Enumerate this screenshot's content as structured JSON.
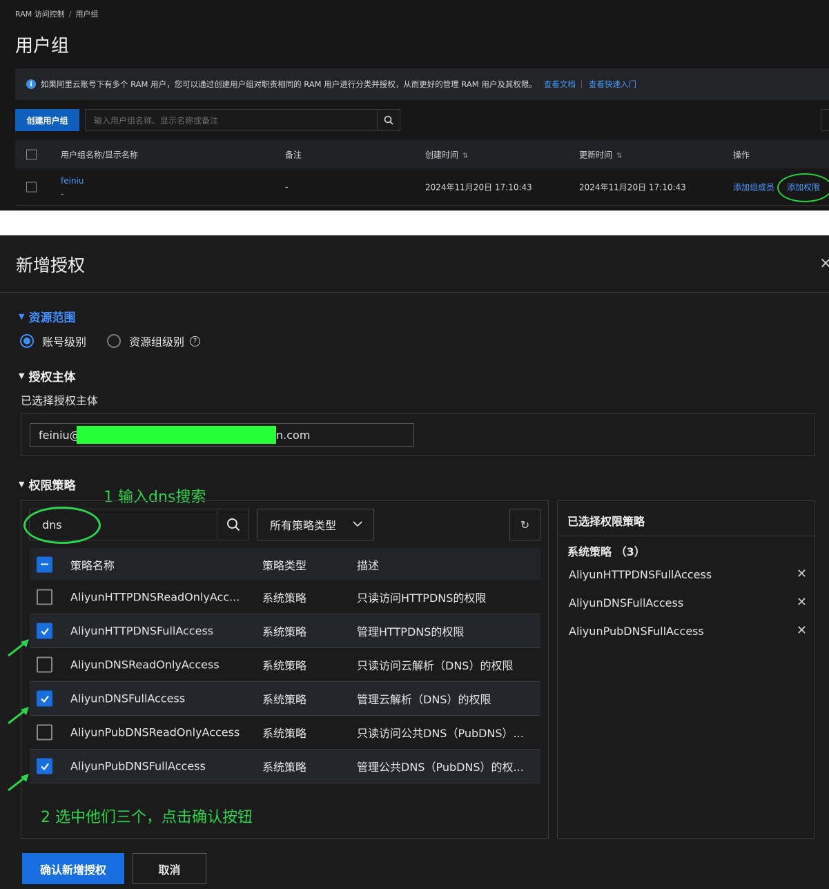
{
  "top": {
    "breadcrumb": [
      "RAM 访问控制",
      "用户组"
    ],
    "breadcrumb_sep": "/",
    "title": "用户组",
    "notice": {
      "text": "如果阿里云账号下有多个 RAM 用户，您可以通过创建用户组对职责相同的 RAM 用户进行分类并授权，从而更好的管理 RAM 用户及其权限。",
      "link1": "查看文档",
      "link2": "查看快速入门"
    },
    "create_button": "创建用户组",
    "search_placeholder": "输入用户组名称、显示名称或备注",
    "columns": [
      "用户组名称/显示名称",
      "备注",
      "创建时间",
      "更新时间",
      "操作"
    ],
    "row": {
      "name": "feiniu",
      "display_name": "-",
      "remark": "-",
      "created": "2024年11月20日 17:10:43",
      "updated": "2024年11月20日 17:10:43",
      "action1": "添加组成员",
      "action2": "添加权限"
    }
  },
  "dialog": {
    "title": "新增授权",
    "close": "×",
    "resource_scope": {
      "label": "资源范围",
      "option1": "账号级别",
      "option2": "资源组级别",
      "selected": "账号级别"
    },
    "principal": {
      "label": "授权主体",
      "selected_label": "已选择授权主体",
      "tag_prefix": "feiniu@",
      "tag_suffix": "n.com"
    },
    "policy": {
      "label": "权限策略",
      "search_value": "dns",
      "type_select": "所有策略类型",
      "columns": [
        "策略名称",
        "策略类型",
        "描述"
      ],
      "rows": [
        {
          "name": "AliyunHTTPDNSReadOnlyAcc...",
          "type": "系统策略",
          "desc": "只读访问HTTPDNS的权限",
          "checked": false
        },
        {
          "name": "AliyunHTTPDNSFullAccess",
          "type": "系统策略",
          "desc": "管理HTTPDNS的权限",
          "checked": true
        },
        {
          "name": "AliyunDNSReadOnlyAccess",
          "type": "系统策略",
          "desc": "只读访问云解析（DNS）的权限",
          "checked": false
        },
        {
          "name": "AliyunDNSFullAccess",
          "type": "系统策略",
          "desc": "管理云解析（DNS）的权限",
          "checked": true
        },
        {
          "name": "AliyunPubDNSReadOnlyAccess",
          "type": "系统策略",
          "desc": "只读访问公共DNS（PubDNS）...",
          "checked": false
        },
        {
          "name": "AliyunPubDNSFullAccess",
          "type": "系统策略",
          "desc": "管理公共DNS（PubDNS）的权...",
          "checked": true
        }
      ]
    },
    "selected_panel": {
      "title": "已选择权限策略",
      "group": "系统策略 （3）",
      "items": [
        "AliyunHTTPDNSFullAccess",
        "AliyunDNSFullAccess",
        "AliyunPubDNSFullAccess"
      ]
    },
    "annotations": {
      "step1": "1 输入dns搜索",
      "step2": "2 选中他们三个，点击确认按钮"
    },
    "confirm_button": "确认新增授权",
    "cancel_button": "取消"
  },
  "colors": {
    "accent": "#1a6fe0",
    "link": "#4c9bff",
    "annotation": "#2bd44a",
    "redaction": "#25ff35"
  }
}
